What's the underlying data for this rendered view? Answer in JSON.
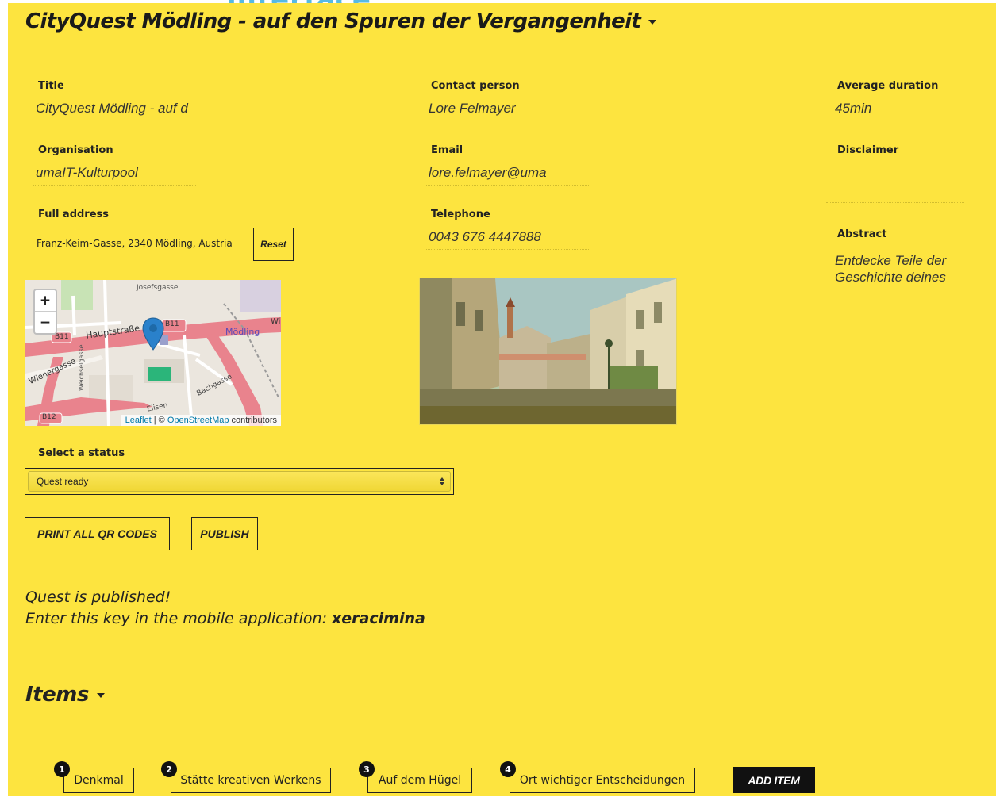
{
  "header": {
    "top_fragment": "interface",
    "quest_title": "CityQuest Mödling - auf den Spuren der Vergangenheit"
  },
  "form": {
    "title": {
      "label": "Title",
      "value": "CityQuest Mödling - auf d"
    },
    "organisation": {
      "label": "Organisation",
      "value": "umaIT-Kulturpool"
    },
    "full_address": {
      "label": "Full address",
      "value": "Franz-Keim-Gasse, 2340 Mödling, Austria",
      "reset_label": "Reset"
    },
    "contact_person": {
      "label": "Contact person",
      "value": "Lore Felmayer"
    },
    "email": {
      "label": "Email",
      "value": "lore.felmayer@uma"
    },
    "telephone": {
      "label": "Telephone",
      "value": "0043 676 4447888"
    },
    "average_duration": {
      "label": "Average duration",
      "value": "45min"
    },
    "disclaimer": {
      "label": "Disclaimer",
      "value": ""
    },
    "abstract": {
      "label": "Abstract",
      "value": "Entdecke Teile der Geschichte deines"
    }
  },
  "map": {
    "zoom_in": "+",
    "zoom_out": "−",
    "street_labels": [
      "Josefsgasse",
      "Hauptstraße",
      "B11",
      "B11",
      "Mödling",
      "Wi",
      "Bachgasse",
      "Elisen",
      "B12",
      "Weichselgasse",
      "Wienergasse"
    ],
    "attribution_leaflet": "Leaflet",
    "attribution_sep": " | © ",
    "attribution_osm": "OpenStreetMap",
    "attribution_suffix": " contributors",
    "marker_color": "#2a81cb"
  },
  "status": {
    "label": "Select a status",
    "selected": "Quest ready"
  },
  "actions": {
    "print_qr": "PRINT ALL QR CODES",
    "publish": "PUBLISH"
  },
  "message": {
    "line1": "Quest is published!",
    "line2_prefix": "Enter this key in the mobile application: ",
    "key": "xeracimina"
  },
  "items": {
    "heading": "Items",
    "list": [
      {
        "number": "1",
        "label": "Denkmal"
      },
      {
        "number": "2",
        "label": "Stätte kreativen Werkens"
      },
      {
        "number": "3",
        "label": "Auf dem Hügel"
      },
      {
        "number": "4",
        "label": "Ort wichtiger Entscheidungen"
      }
    ],
    "add_label": "ADD ITEM"
  },
  "colors": {
    "background": "#fde43f",
    "accent_blue": "#56b9e3"
  }
}
